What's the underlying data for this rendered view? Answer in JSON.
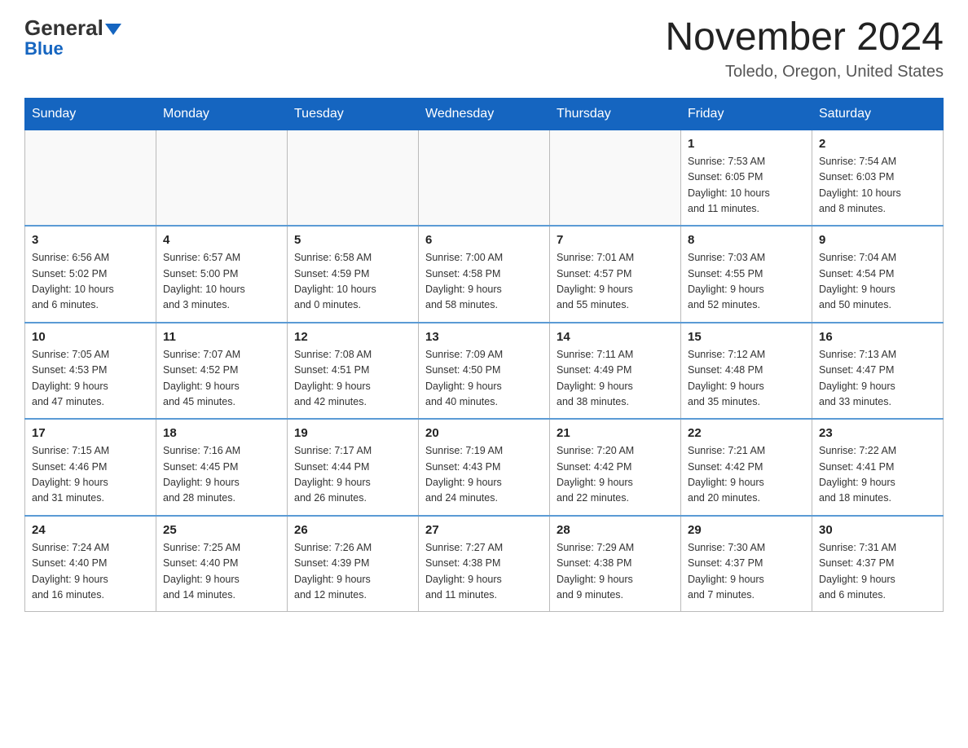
{
  "header": {
    "logo_general": "General",
    "logo_blue": "Blue",
    "month_title": "November 2024",
    "location": "Toledo, Oregon, United States"
  },
  "weekdays": [
    "Sunday",
    "Monday",
    "Tuesday",
    "Wednesday",
    "Thursday",
    "Friday",
    "Saturday"
  ],
  "weeks": [
    [
      {
        "day": "",
        "info": ""
      },
      {
        "day": "",
        "info": ""
      },
      {
        "day": "",
        "info": ""
      },
      {
        "day": "",
        "info": ""
      },
      {
        "day": "",
        "info": ""
      },
      {
        "day": "1",
        "info": "Sunrise: 7:53 AM\nSunset: 6:05 PM\nDaylight: 10 hours\nand 11 minutes."
      },
      {
        "day": "2",
        "info": "Sunrise: 7:54 AM\nSunset: 6:03 PM\nDaylight: 10 hours\nand 8 minutes."
      }
    ],
    [
      {
        "day": "3",
        "info": "Sunrise: 6:56 AM\nSunset: 5:02 PM\nDaylight: 10 hours\nand 6 minutes."
      },
      {
        "day": "4",
        "info": "Sunrise: 6:57 AM\nSunset: 5:00 PM\nDaylight: 10 hours\nand 3 minutes."
      },
      {
        "day": "5",
        "info": "Sunrise: 6:58 AM\nSunset: 4:59 PM\nDaylight: 10 hours\nand 0 minutes."
      },
      {
        "day": "6",
        "info": "Sunrise: 7:00 AM\nSunset: 4:58 PM\nDaylight: 9 hours\nand 58 minutes."
      },
      {
        "day": "7",
        "info": "Sunrise: 7:01 AM\nSunset: 4:57 PM\nDaylight: 9 hours\nand 55 minutes."
      },
      {
        "day": "8",
        "info": "Sunrise: 7:03 AM\nSunset: 4:55 PM\nDaylight: 9 hours\nand 52 minutes."
      },
      {
        "day": "9",
        "info": "Sunrise: 7:04 AM\nSunset: 4:54 PM\nDaylight: 9 hours\nand 50 minutes."
      }
    ],
    [
      {
        "day": "10",
        "info": "Sunrise: 7:05 AM\nSunset: 4:53 PM\nDaylight: 9 hours\nand 47 minutes."
      },
      {
        "day": "11",
        "info": "Sunrise: 7:07 AM\nSunset: 4:52 PM\nDaylight: 9 hours\nand 45 minutes."
      },
      {
        "day": "12",
        "info": "Sunrise: 7:08 AM\nSunset: 4:51 PM\nDaylight: 9 hours\nand 42 minutes."
      },
      {
        "day": "13",
        "info": "Sunrise: 7:09 AM\nSunset: 4:50 PM\nDaylight: 9 hours\nand 40 minutes."
      },
      {
        "day": "14",
        "info": "Sunrise: 7:11 AM\nSunset: 4:49 PM\nDaylight: 9 hours\nand 38 minutes."
      },
      {
        "day": "15",
        "info": "Sunrise: 7:12 AM\nSunset: 4:48 PM\nDaylight: 9 hours\nand 35 minutes."
      },
      {
        "day": "16",
        "info": "Sunrise: 7:13 AM\nSunset: 4:47 PM\nDaylight: 9 hours\nand 33 minutes."
      }
    ],
    [
      {
        "day": "17",
        "info": "Sunrise: 7:15 AM\nSunset: 4:46 PM\nDaylight: 9 hours\nand 31 minutes."
      },
      {
        "day": "18",
        "info": "Sunrise: 7:16 AM\nSunset: 4:45 PM\nDaylight: 9 hours\nand 28 minutes."
      },
      {
        "day": "19",
        "info": "Sunrise: 7:17 AM\nSunset: 4:44 PM\nDaylight: 9 hours\nand 26 minutes."
      },
      {
        "day": "20",
        "info": "Sunrise: 7:19 AM\nSunset: 4:43 PM\nDaylight: 9 hours\nand 24 minutes."
      },
      {
        "day": "21",
        "info": "Sunrise: 7:20 AM\nSunset: 4:42 PM\nDaylight: 9 hours\nand 22 minutes."
      },
      {
        "day": "22",
        "info": "Sunrise: 7:21 AM\nSunset: 4:42 PM\nDaylight: 9 hours\nand 20 minutes."
      },
      {
        "day": "23",
        "info": "Sunrise: 7:22 AM\nSunset: 4:41 PM\nDaylight: 9 hours\nand 18 minutes."
      }
    ],
    [
      {
        "day": "24",
        "info": "Sunrise: 7:24 AM\nSunset: 4:40 PM\nDaylight: 9 hours\nand 16 minutes."
      },
      {
        "day": "25",
        "info": "Sunrise: 7:25 AM\nSunset: 4:40 PM\nDaylight: 9 hours\nand 14 minutes."
      },
      {
        "day": "26",
        "info": "Sunrise: 7:26 AM\nSunset: 4:39 PM\nDaylight: 9 hours\nand 12 minutes."
      },
      {
        "day": "27",
        "info": "Sunrise: 7:27 AM\nSunset: 4:38 PM\nDaylight: 9 hours\nand 11 minutes."
      },
      {
        "day": "28",
        "info": "Sunrise: 7:29 AM\nSunset: 4:38 PM\nDaylight: 9 hours\nand 9 minutes."
      },
      {
        "day": "29",
        "info": "Sunrise: 7:30 AM\nSunset: 4:37 PM\nDaylight: 9 hours\nand 7 minutes."
      },
      {
        "day": "30",
        "info": "Sunrise: 7:31 AM\nSunset: 4:37 PM\nDaylight: 9 hours\nand 6 minutes."
      }
    ]
  ]
}
